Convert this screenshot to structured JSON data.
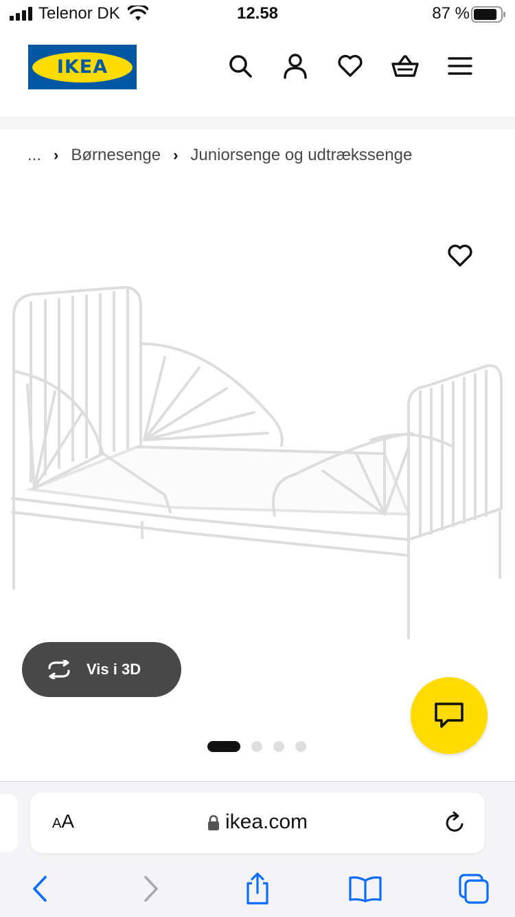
{
  "status_bar": {
    "carrier": "Telenor DK",
    "time": "12.58",
    "battery_percent": "87 %",
    "battery_level": 0.87
  },
  "header": {
    "logo_text": "IKEA",
    "icons": [
      "search-icon",
      "account-icon",
      "wishlist-icon",
      "cart-icon",
      "menu-icon"
    ]
  },
  "breadcrumb": {
    "ellipsis": "...",
    "items": [
      "Børnesenge",
      "Juniorsenge og udtrækssenge"
    ]
  },
  "product": {
    "view_3d_label": "Vis i 3D",
    "image_count": 4,
    "active_image": 1
  },
  "browser": {
    "text_size_label_small": "A",
    "text_size_label_large": "A",
    "url": "ikea.com"
  },
  "colors": {
    "ikea_blue": "#0058a3",
    "ikea_yellow": "#ffdb00",
    "button_dark": "#484848",
    "ios_blue": "#0a6cff"
  }
}
